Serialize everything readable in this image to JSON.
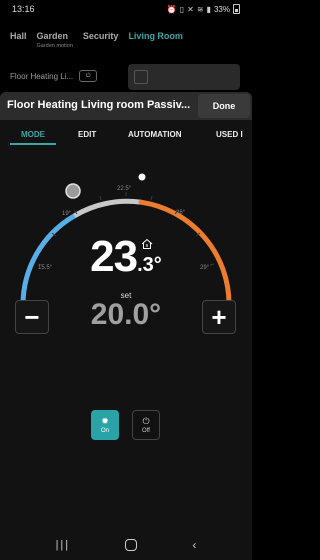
{
  "status_bar": {
    "time": "13:16",
    "battery_text": "33%",
    "icons": [
      "alarm-icon",
      "vibrate-icon",
      "wifi-icon",
      "signal-icon",
      "battery-icon"
    ]
  },
  "background_tabs": [
    {
      "label": "Hall",
      "sub": ""
    },
    {
      "label": "Garden",
      "sub": "Garden motion"
    },
    {
      "label": "Security",
      "sub": ""
    },
    {
      "label": "Living Room",
      "sub": ""
    }
  ],
  "background_card": {
    "label": "Floor Heating Li...",
    "toggle": "⏻"
  },
  "sheet": {
    "title": "Floor Heating Living room Passiv...",
    "done": "Done"
  },
  "mode_tabs": [
    "MODE",
    "EDIT",
    "AUTOMATION",
    "USED I"
  ],
  "thermostat": {
    "current_temp_int": "23",
    "current_temp_dec": ".3°",
    "set_label": "set",
    "set_value": "20.0°",
    "scale_labels": [
      "15.5°",
      "19°",
      "22.5°",
      "26°",
      "29°"
    ],
    "cold_color": "#5aaee8",
    "warm_color": "#ec7d2e",
    "neutral_color": "#c8c8c8"
  },
  "controls": {
    "minus": "−",
    "plus": "+",
    "on_label": "On",
    "off_label": "Off"
  }
}
